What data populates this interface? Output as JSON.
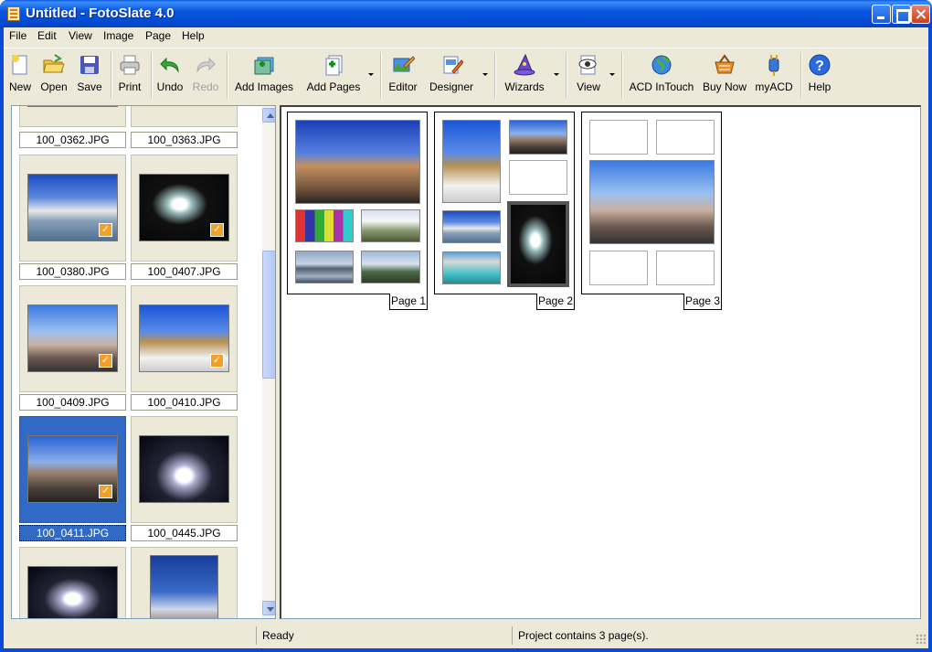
{
  "window": {
    "title": "Untitled - FotoSlate 4.0"
  },
  "menu": [
    "File",
    "Edit",
    "View",
    "Image",
    "Page",
    "Help"
  ],
  "toolbar": {
    "new": "New",
    "open": "Open",
    "save": "Save",
    "print": "Print",
    "undo": "Undo",
    "redo": "Redo",
    "add_images": "Add Images",
    "add_pages": "Add Pages",
    "editor": "Editor",
    "designer": "Designer",
    "wizards": "Wizards",
    "view": "View",
    "acd_intouch": "ACD InTouch",
    "buy_now": "Buy Now",
    "myacd": "myACD",
    "help": "Help"
  },
  "thumbnails": [
    {
      "name": "100_0362.JPG",
      "checked": false,
      "selected": false
    },
    {
      "name": "100_0363.JPG",
      "checked": false,
      "selected": false
    },
    {
      "name": "100_0380.JPG",
      "checked": true,
      "selected": false
    },
    {
      "name": "100_0407.JPG",
      "checked": true,
      "selected": false
    },
    {
      "name": "100_0409.JPG",
      "checked": true,
      "selected": false
    },
    {
      "name": "100_0410.JPG",
      "checked": true,
      "selected": false
    },
    {
      "name": "100_0411.JPG",
      "checked": true,
      "selected": true
    },
    {
      "name": "100_0445.JPG",
      "checked": false,
      "selected": false
    }
  ],
  "pages": [
    {
      "label": "Page 1"
    },
    {
      "label": "Page 2"
    },
    {
      "label": "Page 3"
    }
  ],
  "status": {
    "ready": "Ready",
    "project": "Project contains 3 page(s)."
  },
  "colors": {
    "title_blue": "#0a4ad6",
    "selection": "#316ac5",
    "check_orange": "#f4a026"
  }
}
